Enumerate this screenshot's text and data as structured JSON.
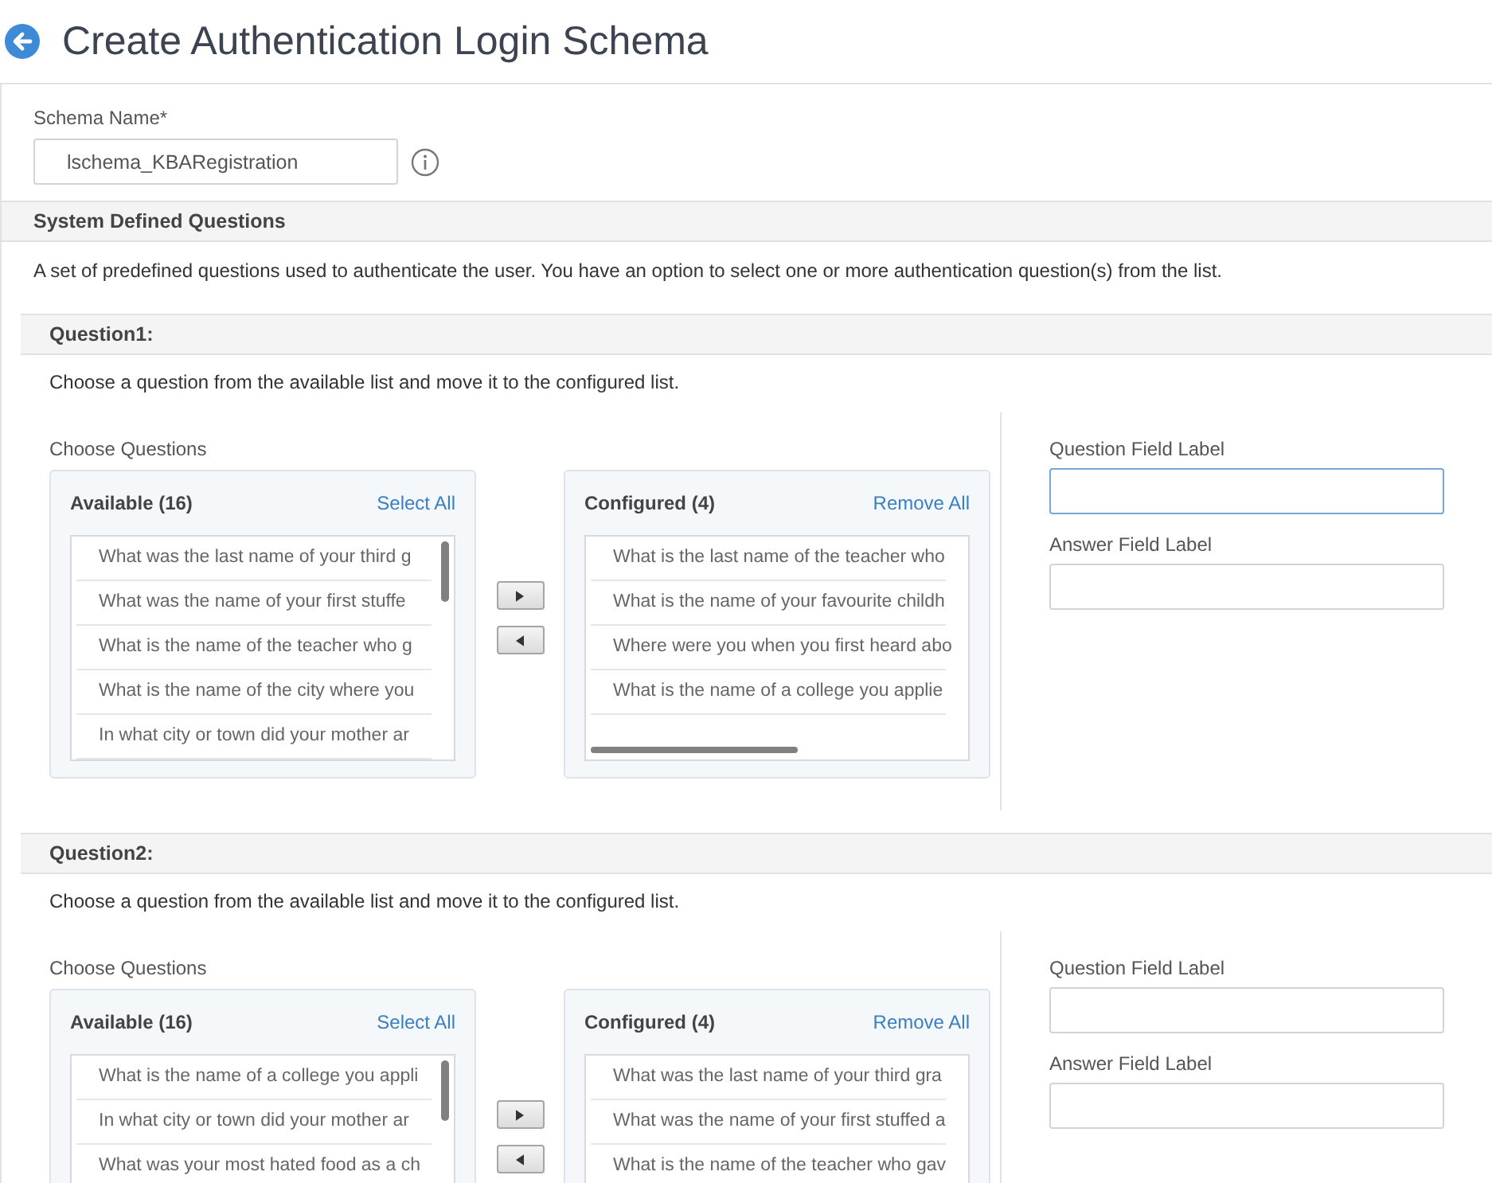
{
  "page": {
    "title": "Create Authentication Login Schema"
  },
  "schema_name": {
    "label": "Schema Name*",
    "value": "lschema_KBARegistration"
  },
  "section": {
    "title": "System Defined Questions",
    "description": "A set of predefined questions used to authenticate the user. You have an option to select one or more authentication question(s) from the list."
  },
  "questions": [
    {
      "title": "Question1:",
      "instruction": "Choose a question from the available list and move it to the configured list.",
      "choose_label": "Choose Questions",
      "available": {
        "title": "Available (16)",
        "action": "Select All",
        "items": [
          "What was the last name of your third g",
          "What was the name of your first stuffe",
          "What is the name of the teacher who g",
          "What is the name of the city where you",
          "In what city or town did your mother ar"
        ]
      },
      "configured": {
        "title": "Configured (4)",
        "action": "Remove All",
        "items": [
          "What is the last name of the teacher who",
          "What is the name of your favourite childh",
          "Where were you when you first heard abo",
          "What is the name of a college you applie"
        ]
      },
      "fields": [
        {
          "label": "Question Field Label",
          "focused": true
        },
        {
          "label": "Answer Field Label",
          "focused": false
        }
      ]
    },
    {
      "title": "Question2:",
      "instruction": "Choose a question from the available list and move it to the configured list.",
      "choose_label": "Choose Questions",
      "available": {
        "title": "Available (16)",
        "action": "Select All",
        "items": [
          "What is the name of a college you appli",
          "In what city or town did your mother ar",
          "What was your most hated food as a ch"
        ]
      },
      "configured": {
        "title": "Configured (4)",
        "action": "Remove All",
        "items": [
          "What was the last name of your third gra",
          "What was the name of your first stuffed a",
          "What is the name of the teacher who gav"
        ]
      },
      "fields": [
        {
          "label": "Question Field Label",
          "focused": false
        },
        {
          "label": "Answer Field Label",
          "focused": false
        }
      ]
    }
  ]
}
